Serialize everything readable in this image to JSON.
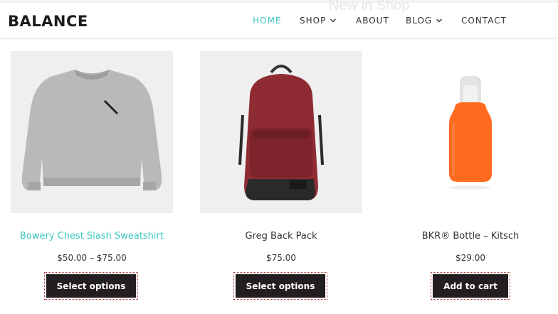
{
  "site": {
    "logo": "BALANCE",
    "ghost_heading": "New in Shop"
  },
  "nav": {
    "items": [
      {
        "label": "HOME",
        "active": true,
        "has_dropdown": false
      },
      {
        "label": "SHOP",
        "active": false,
        "has_dropdown": true
      },
      {
        "label": "ABOUT",
        "active": false,
        "has_dropdown": false
      },
      {
        "label": "BLOG",
        "active": false,
        "has_dropdown": true
      },
      {
        "label": "CONTACT",
        "active": false,
        "has_dropdown": false
      }
    ]
  },
  "products": [
    {
      "title": "Bowery Chest Slash Sweatshirt",
      "price": "$50.00 – $75.00",
      "button": "Select options",
      "image": "gray-sweatshirt",
      "title_is_link": true
    },
    {
      "title": "Greg Back Pack",
      "price": "$75.00",
      "button": "Select options",
      "image": "red-backpack",
      "title_is_link": false
    },
    {
      "title": "BKR® Bottle – Kitsch",
      "price": "$29.00",
      "button": "Add to cart",
      "image": "orange-bottle",
      "title_is_link": false
    }
  ],
  "colors": {
    "accent": "#3cc8c0",
    "button_bg": "#231f20",
    "text": "#333333"
  }
}
